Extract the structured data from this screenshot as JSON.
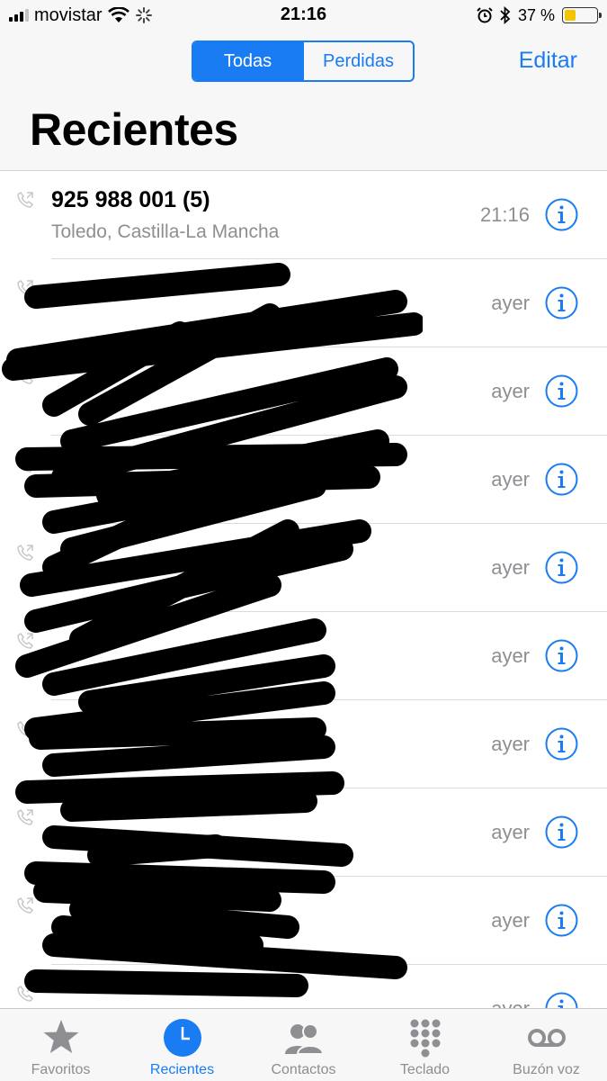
{
  "status_bar": {
    "carrier": "movistar",
    "time": "21:16",
    "battery_percent": "37 %",
    "battery_level": 0.37,
    "icons": [
      "signal-icon",
      "wifi-icon",
      "activity-icon",
      "alarm-icon",
      "bluetooth-icon",
      "battery-icon"
    ]
  },
  "header": {
    "segments": [
      "Todas",
      "Perdidas"
    ],
    "selected_segment": "Todas",
    "edit_label": "Editar",
    "title": "Recientes"
  },
  "calls": [
    {
      "primary": "925 988 001 (5)",
      "secondary": "Toledo, Castilla-La Mancha",
      "time": "21:16"
    },
    {
      "primary": "",
      "secondary": "",
      "time": "ayer"
    },
    {
      "primary": "",
      "secondary": "",
      "time": "ayer"
    },
    {
      "primary": "",
      "secondary": "",
      "time": "ayer"
    },
    {
      "primary": "",
      "secondary": "",
      "time": "ayer"
    },
    {
      "primary": "",
      "secondary": "",
      "time": "ayer"
    },
    {
      "primary": "",
      "secondary": "",
      "time": "ayer"
    },
    {
      "primary": "",
      "secondary": "",
      "time": "ayer"
    },
    {
      "primary": "",
      "secondary": "",
      "time": "ayer"
    },
    {
      "primary": "",
      "secondary": "",
      "time": "ayer"
    }
  ],
  "tabbar": {
    "tabs": [
      {
        "label": "Favoritos",
        "icon": "star-icon"
      },
      {
        "label": "Recientes",
        "icon": "clock-icon",
        "active": true
      },
      {
        "label": "Contactos",
        "icon": "contacts-icon"
      },
      {
        "label": "Teclado",
        "icon": "keypad-icon"
      },
      {
        "label": "Buzón voz",
        "icon": "voicemail-icon"
      }
    ]
  },
  "colors": {
    "accent": "#1a7cf2",
    "secondary_text": "#8e8e93",
    "battery": "#f5c400"
  }
}
